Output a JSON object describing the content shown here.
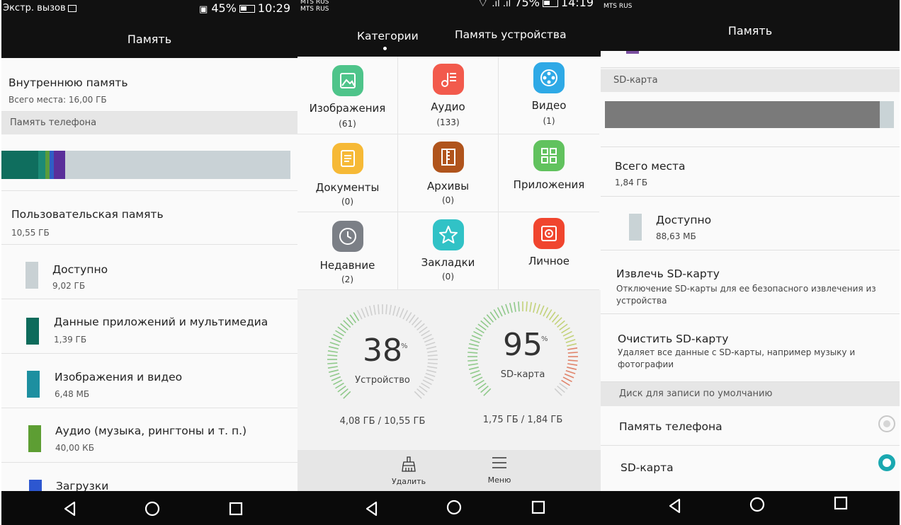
{
  "panel1": {
    "status": {
      "left_text": "Экстр. вызов",
      "battery": "45%",
      "time": "10:29"
    },
    "app_title": "Память",
    "internal": {
      "title": "Внутреннюю память",
      "sub": "Всего места: 16,00 ГБ"
    },
    "section": "Память телефона",
    "usage_bar_colors": [
      "#0f6e5e",
      "#1b8a76",
      "#5a9c3c",
      "#2f5fc4",
      "#5a2f9a",
      "#c9d2d6"
    ],
    "user_memory": {
      "title": "Пользовательская память",
      "size": "10,55 ГБ"
    },
    "items": [
      {
        "label": "Доступно",
        "size": "9,02 ГБ",
        "color": "#c9d1d4"
      },
      {
        "label": "Данные приложений и мультимедиа",
        "size": "1,39 ГБ",
        "color": "#0d6b5b"
      },
      {
        "label": "Изображения и видео",
        "size": "6,48 МБ",
        "color": "#1d8fa0"
      },
      {
        "label": "Аудио (музыка, рингтоны и т. п.)",
        "size": "40,00 КБ",
        "color": "#5d9e33"
      },
      {
        "label": "Загрузки",
        "size": "",
        "color": "#2d57d0"
      }
    ]
  },
  "panel2": {
    "status": {
      "carrier1": "MTS RUS",
      "carrier2": "MTS RUS",
      "battery": "75%",
      "time": "14:19"
    },
    "tabs": [
      "Категории",
      "Память устройства"
    ],
    "categories": [
      {
        "label": "Изображения",
        "count": "(61)",
        "color": "#4ec48a",
        "icon": "image-icon"
      },
      {
        "label": "Аудио",
        "count": "(133)",
        "color": "#f25a4c",
        "icon": "music-icon"
      },
      {
        "label": "Видео",
        "count": "(1)",
        "color": "#2ea9e6",
        "icon": "video-icon"
      },
      {
        "label": "Документы",
        "count": "(0)",
        "color": "#f6b936",
        "icon": "document-icon"
      },
      {
        "label": "Архивы",
        "count": "(0)",
        "color": "#b0541c",
        "icon": "archive-icon"
      },
      {
        "label": "Приложения",
        "count": "",
        "color": "#61c25e",
        "icon": "apps-icon"
      },
      {
        "label": "Недавние",
        "count": "(2)",
        "color": "#7b7f86",
        "icon": "clock-icon"
      },
      {
        "label": "Закладки",
        "count": "(0)",
        "color": "#31c2c6",
        "icon": "star-icon"
      },
      {
        "label": "Личное",
        "count": "",
        "color": "#f0452e",
        "icon": "safe-icon"
      }
    ],
    "gauges": [
      {
        "value": "38",
        "unit": "%",
        "label": "Устройство",
        "usage": "4,08 ГБ / 10,55 ГБ",
        "fraction": 0.38
      },
      {
        "value": "95",
        "unit": "%",
        "label": "SD-карта",
        "usage": "1,75 ГБ / 1,84 ГБ",
        "fraction": 0.95
      }
    ],
    "bottom": {
      "delete": "Удалить",
      "menu": "Меню"
    }
  },
  "panel3": {
    "status": {
      "carrier": "MTS RUS"
    },
    "app_title": "Память",
    "sd_section": "SD-карта",
    "sd_bar": {
      "used_color": "#7a7a7a",
      "free_color": "#c9d3d6",
      "used_fraction": 0.95
    },
    "total": {
      "title": "Всего места",
      "size": "1,84 ГБ"
    },
    "available": {
      "title": "Доступно",
      "size": "88,63 МБ"
    },
    "eject": {
      "title": "Извлечь SD-карту",
      "sub": "Отключение SD-карты для ее безопасного извлечения из устройства"
    },
    "clear": {
      "title": "Очистить SD-карту",
      "sub": "Удаляет все данные с SD-карты, например музыку и фотографии"
    },
    "default_section": "Диск для записи по умолчанию",
    "options": [
      {
        "label": "Память телефона",
        "selected": false
      },
      {
        "label": "SD-карта",
        "selected": true
      }
    ],
    "accent": "#1aa8b0"
  }
}
